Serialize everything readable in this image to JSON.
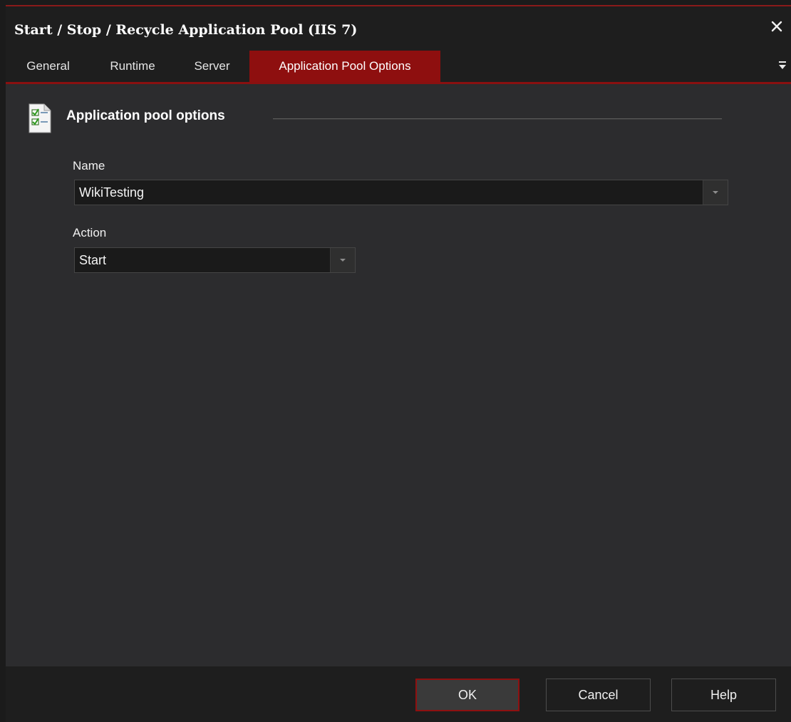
{
  "window": {
    "title": "Start / Stop / Recycle Application Pool (IIS 7)"
  },
  "tabs": [
    {
      "label": "General"
    },
    {
      "label": "Runtime"
    },
    {
      "label": "Server"
    },
    {
      "label": "Application Pool Options",
      "active": true
    }
  ],
  "section": {
    "title": "Application pool options",
    "icon": "checklist-document-icon"
  },
  "name_field": {
    "label": "Name",
    "value": "WikiTesting"
  },
  "action_field": {
    "label": "Action",
    "value": "Start"
  },
  "buttons": {
    "ok": "OK",
    "cancel": "Cancel",
    "help": "Help"
  },
  "colors": {
    "accent": "#8e0f0f",
    "background": "#2c2c2e",
    "chrome": "#1e1e1e"
  }
}
